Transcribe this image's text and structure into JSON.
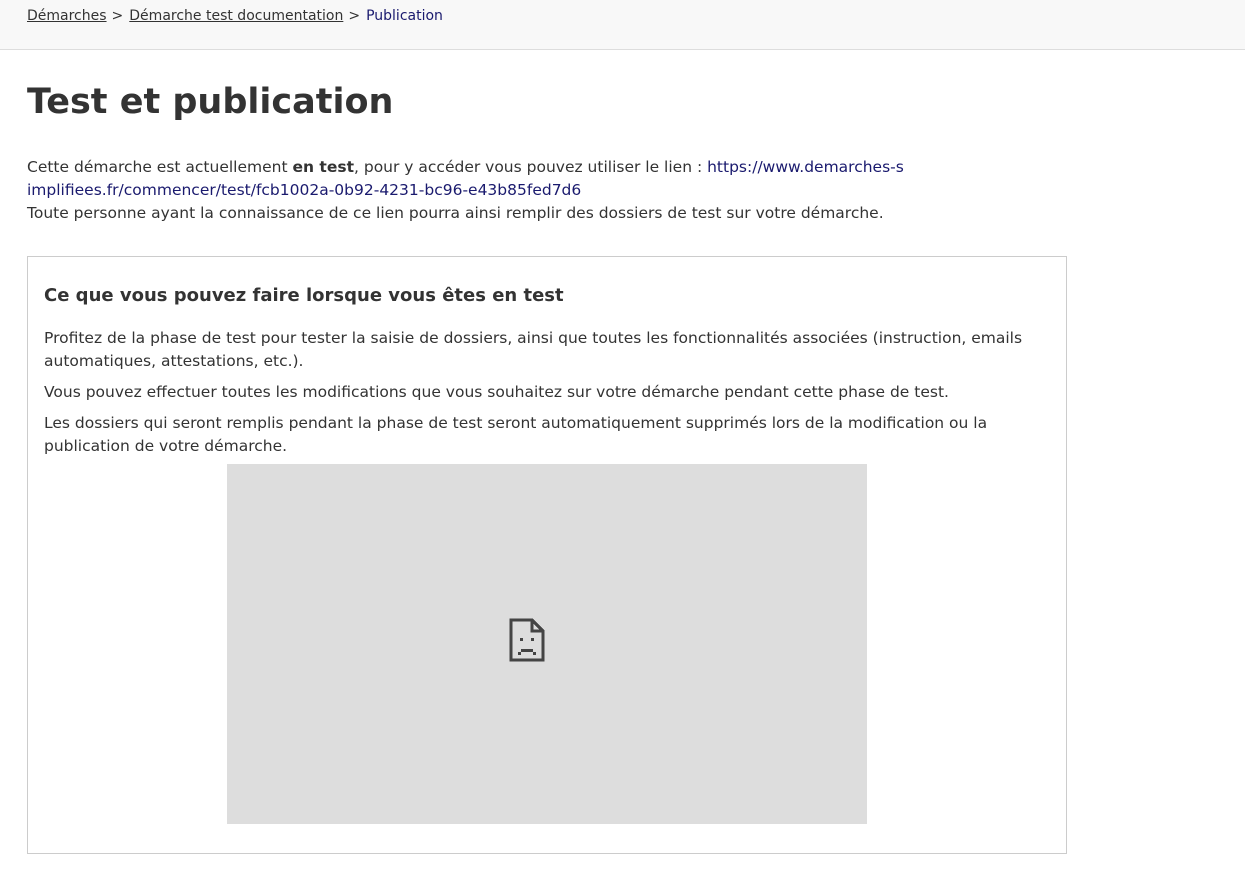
{
  "breadcrumb": {
    "items": [
      {
        "label": "Démarches"
      },
      {
        "label": "Démarche test documentation"
      }
    ],
    "separator": ">",
    "current": "Publication"
  },
  "page": {
    "title": "Test et publication"
  },
  "intro": {
    "text_before": "Cette démarche est actuellement ",
    "status": "en test",
    "text_after": ", pour y accéder vous pouvez utiliser le lien : ",
    "link": "https://www.demarches-simplifiees.fr/commencer/test/fcb1002a-0b92-4231-bc96-e43b85fed7d6",
    "line2": "Toute personne ayant la connaissance de ce lien pourra ainsi remplir des dossiers de test sur votre démarche."
  },
  "card": {
    "title": "Ce que vous pouvez faire lorsque vous êtes en test",
    "paragraphs": [
      "Profitez de la phase de test pour tester la saisie de dossiers, ainsi que toutes les fonctionnalités associées (instruction, emails automatiques, attestations, etc.).",
      "Vous pouvez effectuer toutes les modifications que vous souhaitez sur votre démarche pendant cette phase de test.",
      "Les dossiers qui seront remplis pendant la phase de test seront automatiquement supprimés lors de la modification ou la publication de votre démarche."
    ],
    "media_icon": "broken-image-icon"
  },
  "colors": {
    "link": "#1a1a6e",
    "text": "#333333",
    "topbar_bg": "#f8f8f8",
    "media_bg": "#dddddd"
  }
}
